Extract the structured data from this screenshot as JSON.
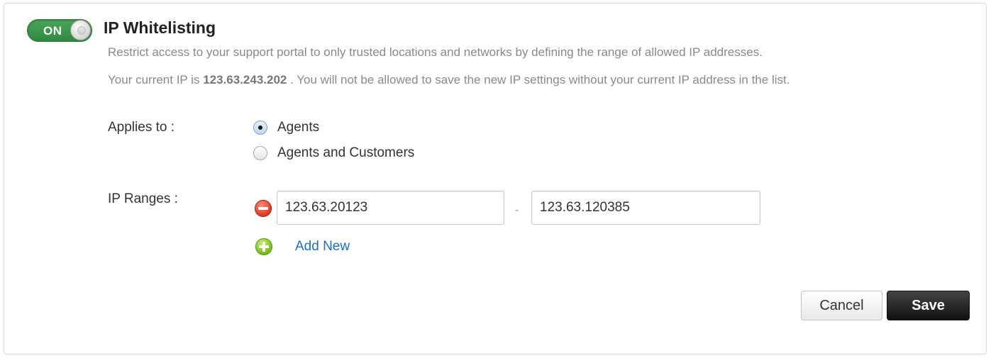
{
  "toggle": {
    "label": "ON",
    "state": "on",
    "color": "#3d9a4c"
  },
  "header": {
    "title": "IP Whitelisting"
  },
  "description": {
    "line1": "Restrict access to your support portal to only trusted locations and networks by defining the range of allowed IP addresses.",
    "line2_prefix": "Your current IP is",
    "current_ip": "123.63.243.202",
    "line2_suffix": ". You will not be allowed to save the new IP settings without your current IP address in the list."
  },
  "applies_to": {
    "label": "Applies to :",
    "options": [
      {
        "label": "Agents",
        "checked": true
      },
      {
        "label": "Agents and Customers",
        "checked": false
      }
    ]
  },
  "ip_ranges": {
    "label": "IP Ranges :",
    "ranges": [
      {
        "from": "123.63.20123",
        "separator": "-",
        "to": "123.63.120385"
      }
    ],
    "add_label": "Add New",
    "remove_icon": "minus-circle-icon",
    "add_icon": "plus-circle-icon"
  },
  "actions": {
    "cancel_label": "Cancel",
    "save_label": "Save",
    "link_color": "#1a6fc9"
  }
}
